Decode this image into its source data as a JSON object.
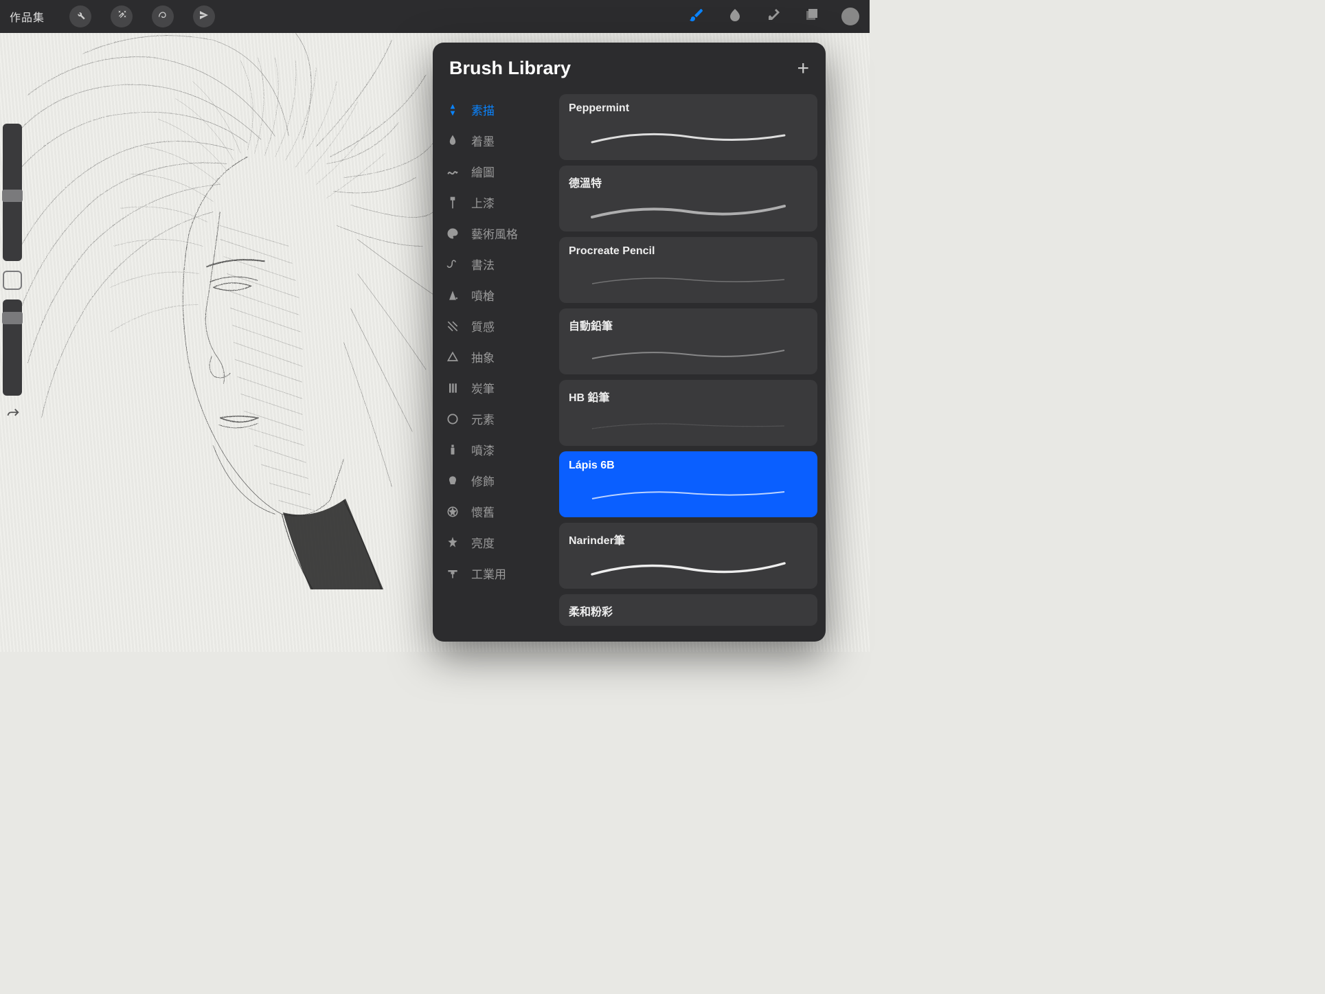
{
  "toolbar": {
    "gallery_label": "作品集"
  },
  "popover": {
    "title": "Brush Library",
    "categories": [
      {
        "id": "sketch",
        "label": "素描"
      },
      {
        "id": "ink",
        "label": "着墨"
      },
      {
        "id": "draw",
        "label": "繪圖"
      },
      {
        "id": "paint",
        "label": "上漆"
      },
      {
        "id": "artistic",
        "label": "藝術風格"
      },
      {
        "id": "calligraphy",
        "label": "書法"
      },
      {
        "id": "airbrush",
        "label": "噴槍"
      },
      {
        "id": "texture",
        "label": "質感"
      },
      {
        "id": "abstract",
        "label": "抽象"
      },
      {
        "id": "charcoal",
        "label": "炭筆"
      },
      {
        "id": "elements",
        "label": "元素"
      },
      {
        "id": "spray",
        "label": "噴漆"
      },
      {
        "id": "touchup",
        "label": "修飾"
      },
      {
        "id": "retro",
        "label": "懷舊"
      },
      {
        "id": "luminance",
        "label": "亮度"
      },
      {
        "id": "industrial",
        "label": "工業用"
      }
    ],
    "active_category": "sketch",
    "brushes": [
      {
        "name": "Peppermint",
        "selected": false
      },
      {
        "name": "德溫特",
        "selected": false
      },
      {
        "name": "Procreate Pencil",
        "selected": false
      },
      {
        "name": "自動鉛筆",
        "selected": false
      },
      {
        "name": "HB 鉛筆",
        "selected": false
      },
      {
        "name": "Lápis 6B",
        "selected": true
      },
      {
        "name": "Narinder筆",
        "selected": false
      },
      {
        "name": "柔和粉彩",
        "selected": false
      }
    ]
  }
}
